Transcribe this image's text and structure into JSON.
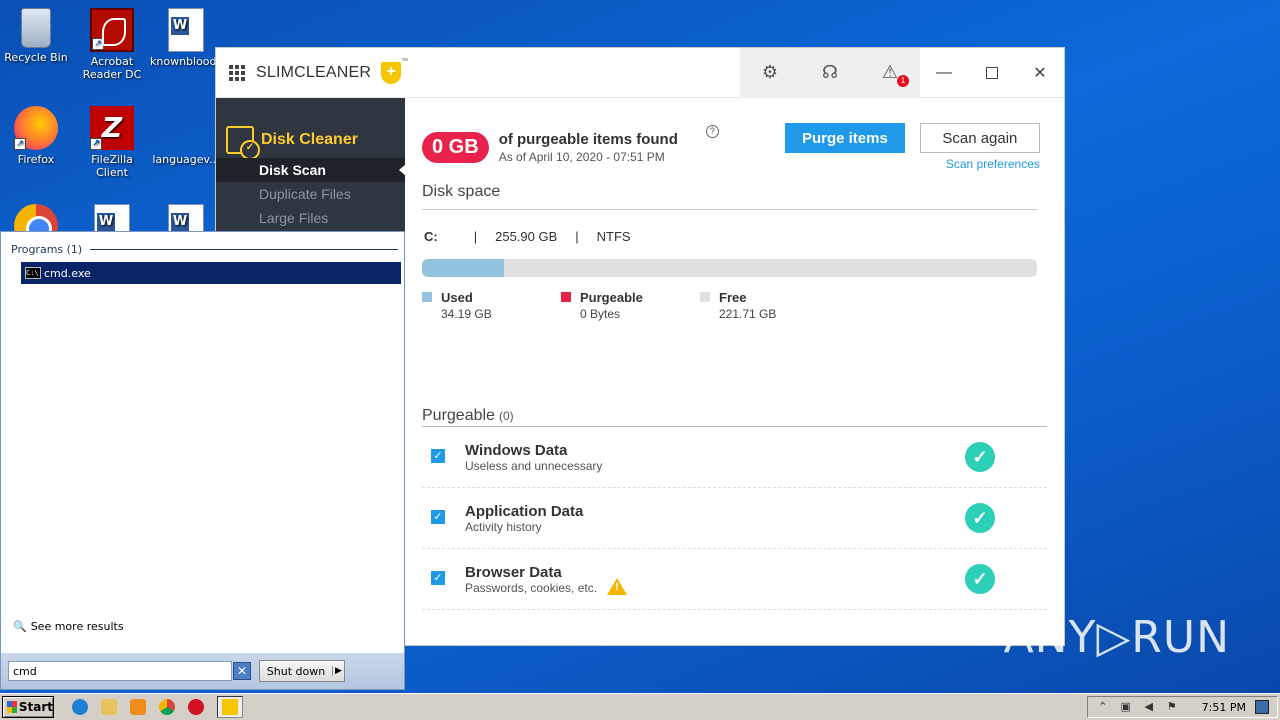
{
  "desktop": {
    "icons": [
      {
        "label": "Recycle Bin"
      },
      {
        "label": "Acrobat Reader DC"
      },
      {
        "label": "knownblood..."
      },
      {
        "label": "Firefox"
      },
      {
        "label": "FileZilla Client"
      },
      {
        "label": "languagev..."
      }
    ]
  },
  "start_menu": {
    "section_header": "Programs (1)",
    "result_item": "cmd.exe",
    "see_more": "See more results",
    "search_value": "cmd",
    "clear_glyph": "✕",
    "shutdown_label": "Shut down",
    "shutdown_arrow": "▶"
  },
  "app": {
    "title": "SLIMCLEANER",
    "trademark": "™",
    "alert_count": "1",
    "icons": {
      "settings": "gear-icon",
      "support": "headset-icon",
      "alert": "warning-icon"
    },
    "sidebar": {
      "section": "Disk Cleaner",
      "items": [
        "Disk Scan",
        "Duplicate Files",
        "Large Files"
      ]
    },
    "summary": {
      "amount": "0 GB",
      "headline": "of purgeable items found",
      "date": "As of April 10, 2020 - 07:51 PM",
      "help": "?",
      "purge_button": "Purge items",
      "scan_button": "Scan again",
      "scan_prefs": "Scan preferences"
    },
    "disk": {
      "title": "Disk space",
      "drive": "C:",
      "sep": "|",
      "size": "255.90 GB",
      "fs": "NTFS",
      "used_fraction": 0.1336,
      "legend": [
        {
          "name": "Used",
          "value": "34.19 GB",
          "color": "#94c3e0"
        },
        {
          "name": "Purgeable",
          "value": "0 Bytes",
          "color": "#e8224a"
        },
        {
          "name": "Free",
          "value": "221.71 GB",
          "color": "#e0e0e0"
        }
      ]
    },
    "purgeable": {
      "title": "Purgeable",
      "count": "(0)",
      "rows": [
        {
          "title": "Windows Data",
          "subtitle": "Useless and unnecessary"
        },
        {
          "title": "Application Data",
          "subtitle": "Activity history"
        },
        {
          "title": "Browser Data",
          "subtitle": "Passwords, cookies, etc."
        }
      ]
    },
    "accent": "#1e9ae8"
  },
  "watermark": "ANY▷RUN",
  "taskbar": {
    "start_label": "Start",
    "clock": "7:51 PM"
  }
}
